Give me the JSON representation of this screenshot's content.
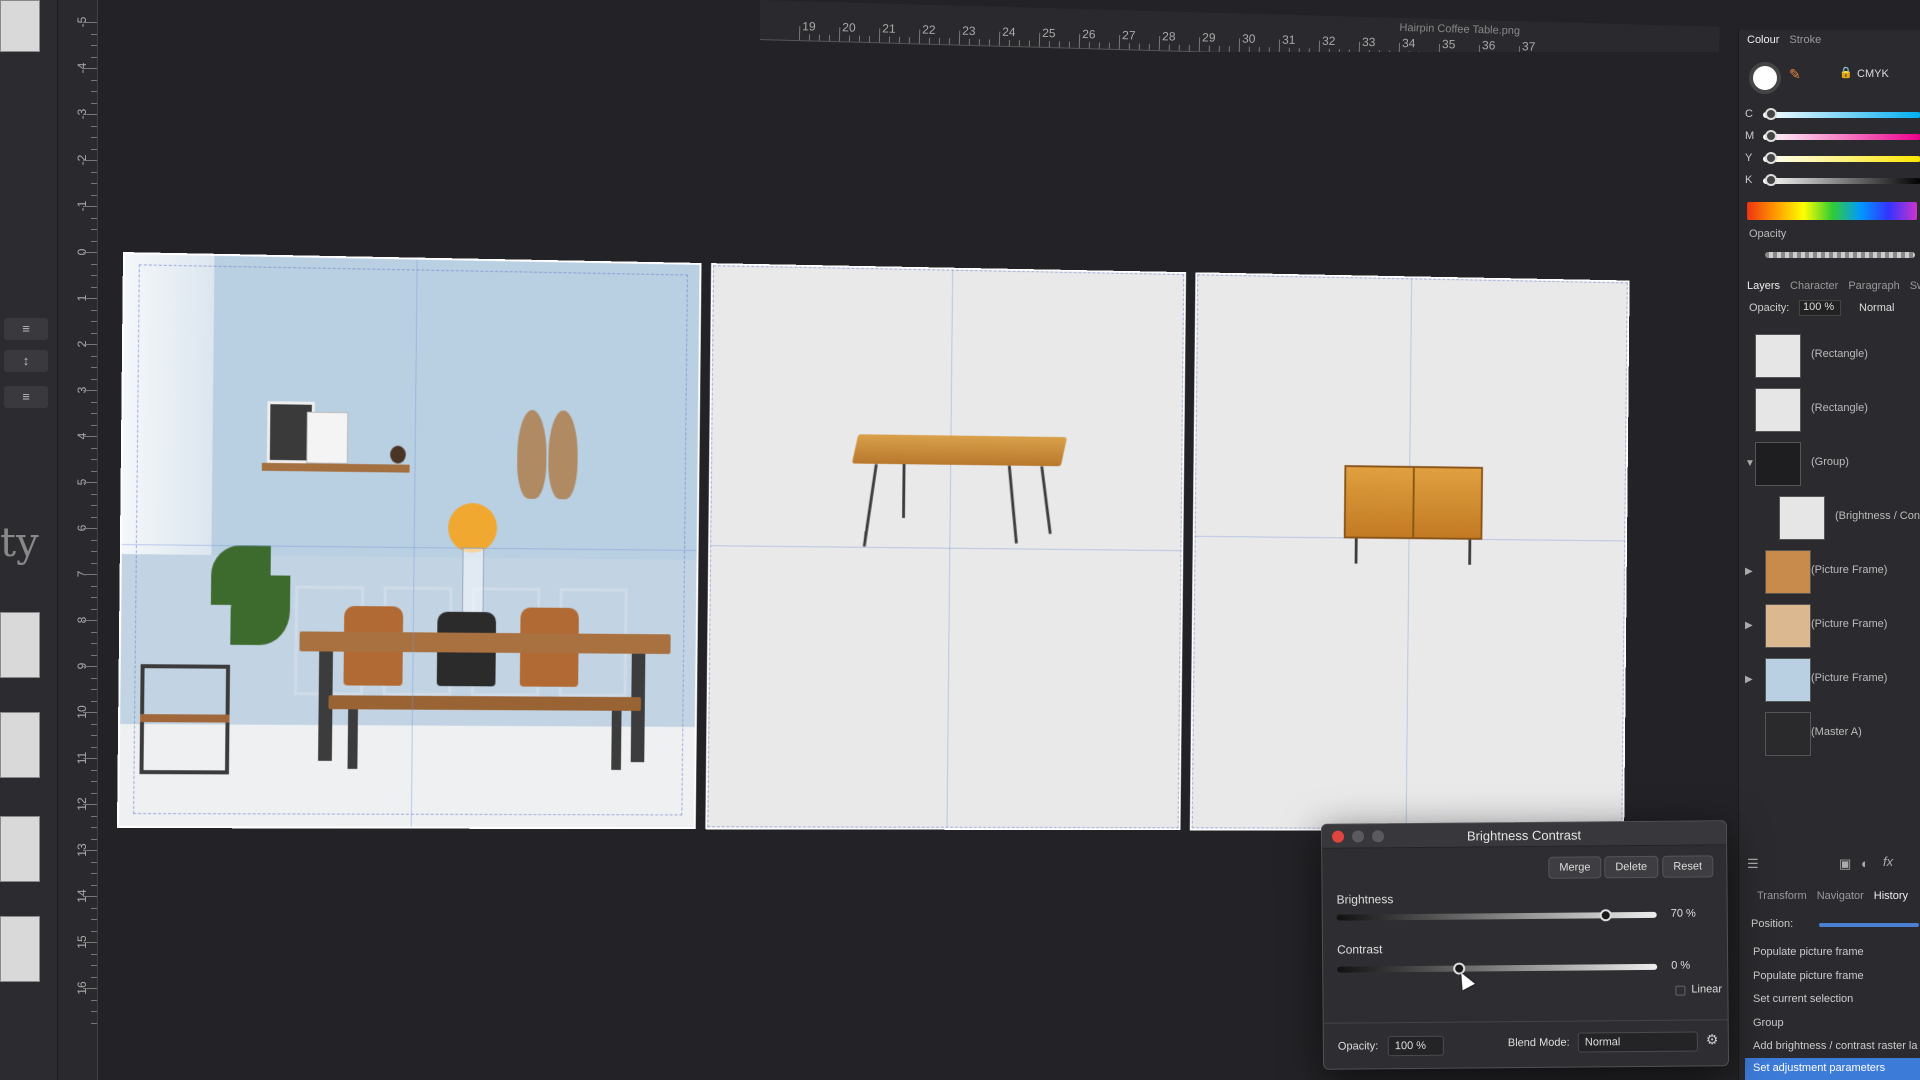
{
  "document": {
    "title": "Hairpin Coffee Table.png"
  },
  "left_toolbar": {
    "partial_text": "ty"
  },
  "rulers": {
    "top_numbers": [
      "19",
      "20",
      "21",
      "22",
      "23",
      "24",
      "25",
      "26",
      "27",
      "28",
      "29",
      "30",
      "31",
      "32",
      "33",
      "34",
      "35",
      "36",
      "37"
    ],
    "left_numbers": [
      "-5",
      "-4",
      "-3",
      "-2",
      "-1",
      "0",
      "1",
      "2",
      "3",
      "4",
      "5",
      "6",
      "7",
      "8",
      "9",
      "10",
      "11",
      "12",
      "13",
      "14",
      "15",
      "16"
    ]
  },
  "colour_panel": {
    "tabs": [
      "Colour",
      "Stroke"
    ],
    "mode": "CMYK",
    "channels": [
      "C",
      "M",
      "Y",
      "K"
    ],
    "opacity_label": "Opacity"
  },
  "layers_panel": {
    "tabs": [
      "Layers",
      "Character",
      "Paragraph",
      "Swat"
    ],
    "opacity_label": "Opacity:",
    "opacity_value": "100 %",
    "blend_mode": "Normal",
    "items": [
      {
        "name": "(Rectangle)"
      },
      {
        "name": "(Rectangle)"
      },
      {
        "name": "(Group)"
      },
      {
        "name": "(Brightness / Contr"
      },
      {
        "name": "(Picture Frame)"
      },
      {
        "name": "(Picture Frame)"
      },
      {
        "name": "(Picture Frame)"
      },
      {
        "name": "(Master A)"
      }
    ]
  },
  "history_panel": {
    "tabs": [
      "Transform",
      "Navigator",
      "History"
    ],
    "position_label": "Position:",
    "items": [
      "Populate picture frame",
      "Populate picture frame",
      "Set current selection",
      "Group",
      "Add brightness / contrast raster la",
      "Set adjustment parameters"
    ]
  },
  "bc_dialog": {
    "title": "Brightness Contrast",
    "merge_label": "Merge",
    "delete_label": "Delete",
    "reset_label": "Reset",
    "brightness_label": "Brightness",
    "brightness_value": "70 %",
    "brightness_level": 0.84,
    "contrast_label": "Contrast",
    "contrast_value": "0 %",
    "contrast_level": 0.38,
    "linear_label": "Linear",
    "opacity_label": "Opacity:",
    "opacity_value": "100 %",
    "blend_mode_label": "Blend Mode:",
    "blend_mode_value": "Normal"
  },
  "colors": {
    "accent": "#3d7bd9",
    "close": "#e0443e",
    "minimize": "#5a5a5f",
    "zoom": "#5a5a5f"
  }
}
